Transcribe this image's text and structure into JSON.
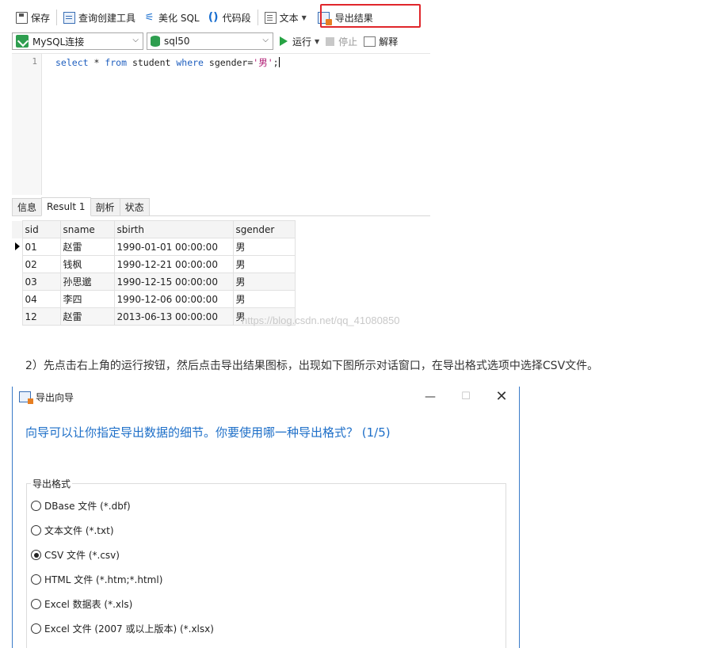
{
  "toolbar": {
    "save": "保存",
    "query_builder": "查询创建工具",
    "beautify_sql": "美化 SQL",
    "code_snippet": "代码段",
    "text": "文本",
    "export_result": "导出结果"
  },
  "connection": {
    "connection_name": "MySQL连接",
    "database": "sql50",
    "run": "运行",
    "stop": "停止",
    "explain": "解释"
  },
  "editor": {
    "line_number": "1",
    "kw_select": "select",
    "star": " * ",
    "kw_from": "from",
    "table": " student ",
    "kw_where": "where",
    "condition": " sgender=",
    "literal": "'男'",
    "terminator": ";"
  },
  "result_tabs": [
    "信息",
    "Result 1",
    "剖析",
    "状态"
  ],
  "grid": {
    "columns": [
      "sid",
      "sname",
      "sbirth",
      "sgender"
    ],
    "rows": [
      [
        "01",
        "赵雷",
        "1990-01-01 00:00:00",
        "男"
      ],
      [
        "02",
        "钱枫",
        "1990-12-21 00:00:00",
        "男"
      ],
      [
        "03",
        "孙思邈",
        "1990-12-15 00:00:00",
        "男"
      ],
      [
        "04",
        "李四",
        "1990-12-06 00:00:00",
        "男"
      ],
      [
        "12",
        "赵雷",
        "2013-06-13 00:00:00",
        "男"
      ]
    ]
  },
  "watermark": "https://blog.csdn.net/qq_41080850",
  "instruction": "2）先点击右上角的运行按钮，然后点击导出结果图标，出现如下图所示对话窗口，在导出格式选项中选择CSV文件。",
  "dialog": {
    "title": "导出向导",
    "minimize": "—",
    "maximize": "☐",
    "close": "✕",
    "question": "向导可以让你指定导出数据的细节。你要使用哪一种导出格式？ (1/5)",
    "group_label": "导出格式",
    "options": [
      "DBase 文件 (*.dbf)",
      "文本文件 (*.txt)",
      "CSV 文件 (*.csv)",
      "HTML 文件 (*.htm;*.html)",
      "Excel 数据表 (*.xls)",
      "Excel 文件 (2007 或以上版本) (*.xlsx)"
    ]
  }
}
